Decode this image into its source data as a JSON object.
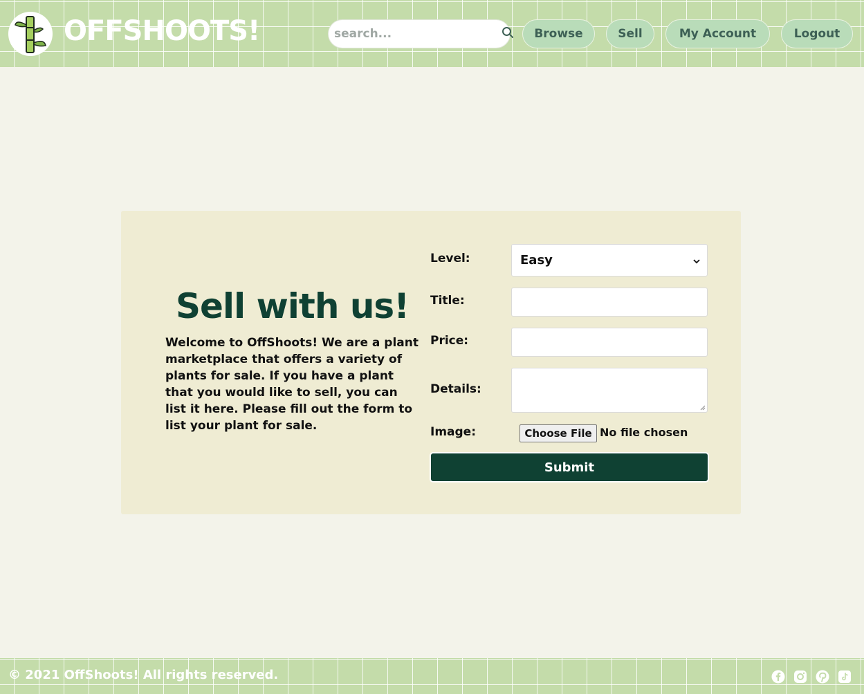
{
  "header": {
    "brand": "OFFSHOOTS!",
    "search_placeholder": "search...",
    "nav": {
      "browse": "Browse",
      "sell": "Sell",
      "account": "My Account",
      "logout": "Logout"
    }
  },
  "hero": {
    "title": "Sell with us!",
    "text": "Welcome to OffShoots! We are a plant marketplace that offers a variety of plants for sale. If you have a plant that you would like to sell, you can list it here. Please fill out the form to list your plant for sale."
  },
  "form": {
    "level_label": "Level:",
    "level_value": "Easy",
    "title_label": "Title:",
    "title_value": "",
    "price_label": "Price:",
    "price_value": "",
    "details_label": "Details:",
    "details_value": "",
    "image_label": "Image:",
    "file_button": "Choose File",
    "file_status": "No file chosen",
    "submit": "Submit"
  },
  "footer": {
    "copyright": "© 2021 OffShoots! All rights reserved.",
    "social_icons": [
      "facebook-icon",
      "instagram-icon",
      "pinterest-icon",
      "tiktok-icon"
    ]
  },
  "colors": {
    "header_green": "#c4dcaa",
    "nav_button": "#b9dcb9",
    "dark_green": "#0f4133",
    "panel": "#efecd3",
    "page_bg": "#f3f3ea"
  }
}
